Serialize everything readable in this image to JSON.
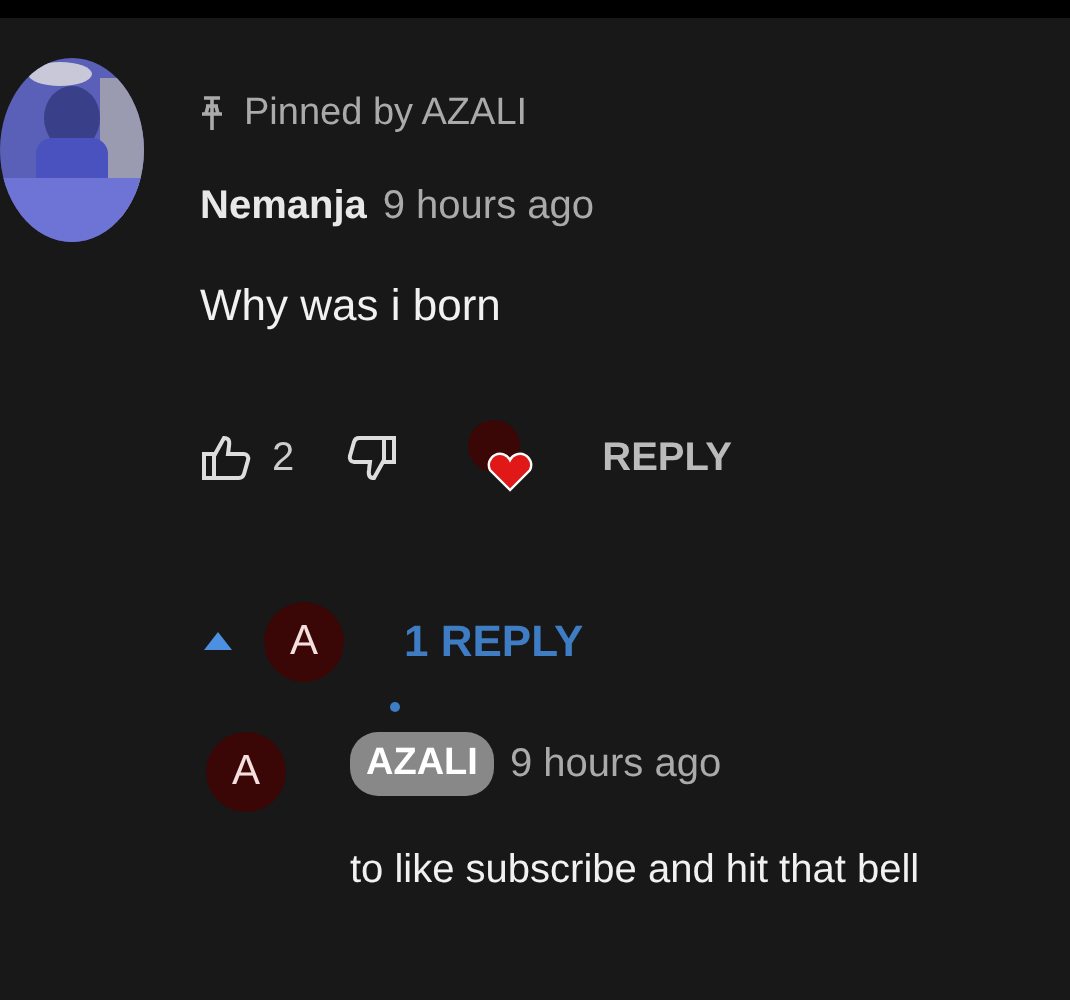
{
  "comment": {
    "pinned_label": "Pinned by AZALI",
    "author": "Nemanja",
    "time": "9 hours ago",
    "text": "Why was i born",
    "likes": "2",
    "hearted": true,
    "reply_button": "REPLY"
  },
  "replies_toggle": {
    "expanded": true,
    "avatar_letter": "A",
    "label": "1 REPLY"
  },
  "reply": {
    "avatar_letter": "A",
    "author": "AZALI",
    "author_is_creator": true,
    "time": "9 hours ago",
    "text": "to like subscribe and hit that bell"
  }
}
